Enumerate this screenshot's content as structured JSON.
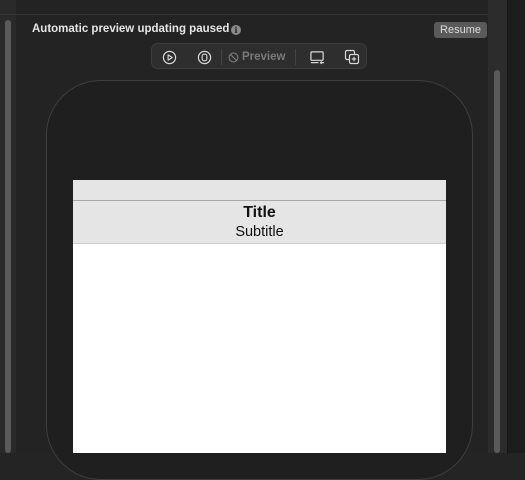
{
  "banner": {
    "message": "Automatic preview updating paused",
    "resume_label": "Resume"
  },
  "toolbar": {
    "live_icon": "play-circle-icon",
    "selectable_icon": "cursor-circle-icon",
    "preview_label": "Preview",
    "preview_icon": "no-entry-icon",
    "device_settings_icon": "device-settings-icon",
    "duplicate_icon": "duplicate-preview-icon"
  },
  "preview": {
    "nav_title": "Title",
    "nav_subtitle": "Subtitle"
  },
  "colors": {
    "background": "#242424",
    "resume_button": "#5a5a5a",
    "nav_bar": "#e5e5e5",
    "screen": "#ffffff"
  }
}
